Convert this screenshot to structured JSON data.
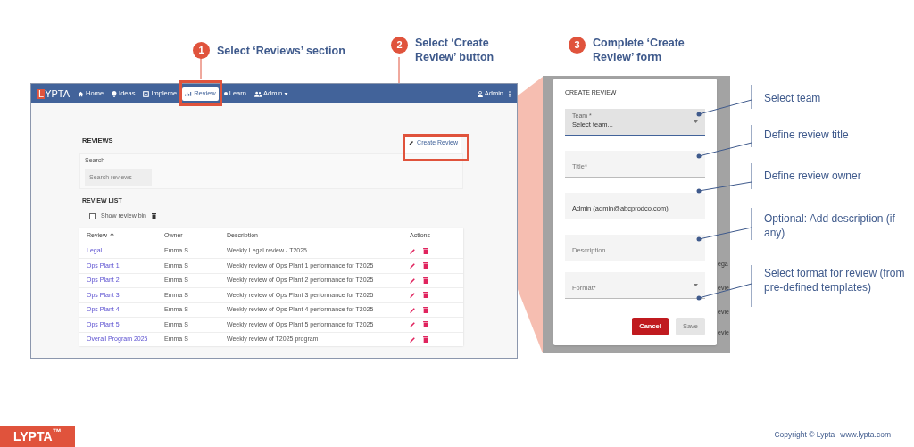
{
  "steps": [
    {
      "number": "1",
      "text": "Select ‘Reviews’ section"
    },
    {
      "number": "2",
      "text": "Select ‘Create Review’ button"
    },
    {
      "number": "3",
      "text": "Complete ‘Create Review’ form"
    }
  ],
  "app": {
    "logo_mark": "L",
    "logo_rest": "YPTA",
    "nav": [
      {
        "label": "Home",
        "selected": false
      },
      {
        "label": "Ideas",
        "selected": false
      },
      {
        "label": "Impleme",
        "selected": false
      },
      {
        "label": "Review",
        "selected": true
      },
      {
        "label": "Learn",
        "selected": false
      },
      {
        "label": "Admin",
        "selected": false
      }
    ],
    "user": "Admin",
    "page_title": "REVIEWS",
    "create_button": "Create Review",
    "search": {
      "label": "Search",
      "placeholder": "Search reviews"
    },
    "list_title": "REVIEW LIST",
    "show_bin": {
      "label": "Show review bin",
      "checked": false
    },
    "columns": [
      "Review",
      "Owner",
      "Description",
      "Actions"
    ],
    "rows": [
      {
        "review": "Legal",
        "owner": "Emma S",
        "description": "Weekly Legal review - T2025"
      },
      {
        "review": "Ops Plant 1",
        "owner": "Emma S",
        "description": "Weekly review of Ops Plant 1 performance for T2025"
      },
      {
        "review": "Ops Plant 2",
        "owner": "Emma S",
        "description": "Weekly review of Ops Plant 2 performance for T2025"
      },
      {
        "review": "Ops Plant 3",
        "owner": "Emma S",
        "description": "Weekly review of Ops Plant 3 performance for T2025"
      },
      {
        "review": "Ops Plant 4",
        "owner": "Emma S",
        "description": "Weekly review of Ops Plant 4 performance for T2025"
      },
      {
        "review": "Ops Plant 5",
        "owner": "Emma S",
        "description": "Weekly review of Ops Plant 5 performance for T2025"
      },
      {
        "review": "Overall Program 2025",
        "owner": "Emma S",
        "description": "Weekly review of T2025 program"
      }
    ]
  },
  "dialog": {
    "title": "CREATE REVIEW",
    "fields": [
      {
        "kind": "select",
        "label": "Team *",
        "value": "Select team..."
      },
      {
        "kind": "text",
        "placeholder": "Title*"
      },
      {
        "kind": "text",
        "value": "Admin (admin@abcprodco.com)"
      },
      {
        "kind": "text",
        "placeholder": "Description"
      },
      {
        "kind": "select",
        "placeholder": "Format*"
      }
    ],
    "buttons": [
      {
        "label": "Cancel",
        "kind": "primary",
        "disabled": false
      },
      {
        "label": "Save",
        "kind": "secondary",
        "disabled": true
      }
    ],
    "backdrop_fragments": [
      "ega",
      "evie",
      "evie",
      "evie"
    ]
  },
  "annotations": [
    "Select team",
    "Define review title",
    "Define review owner",
    "Optional: Add description (if any)",
    "Select format for review (from pre-defined templates)"
  ],
  "footer": {
    "logo": "LYPTA$^{™}$",
    "copyright": "Copyright © Lypta",
    "url": "www.lypta.com"
  }
}
